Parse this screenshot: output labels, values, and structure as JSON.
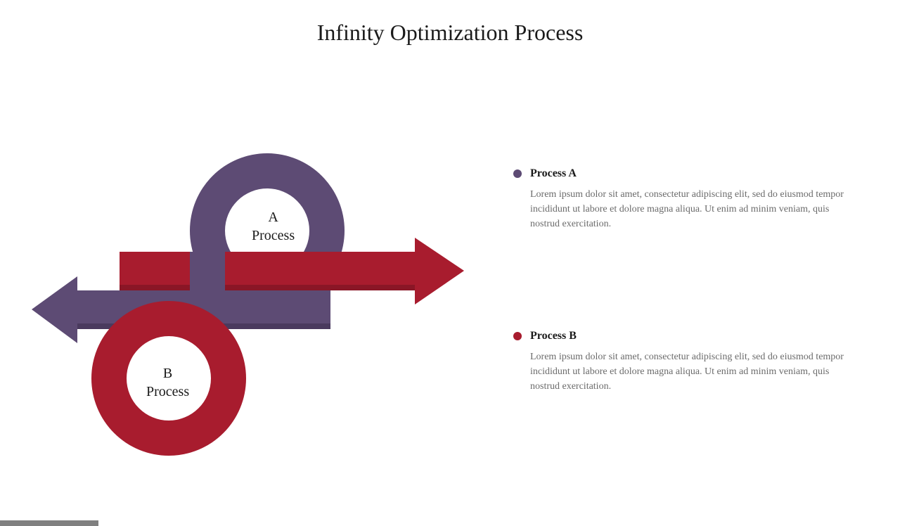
{
  "title": "Infinity Optimization Process",
  "diagram": {
    "labelA_line1": "A",
    "labelA_line2": "Process",
    "labelB_line1": "B",
    "labelB_line2": "Process"
  },
  "processes": [
    {
      "title": "Process A",
      "description": "Lorem ipsum dolor sit amet, consectetur adipiscing elit, sed do eiusmod tempor incididunt ut labore et dolore magna aliqua. Ut enim ad minim veniam, quis nostrud exercitation.",
      "color": "#5d4b74"
    },
    {
      "title": "Process B",
      "description": "Lorem ipsum dolor sit amet, consectetur adipiscing elit, sed do eiusmod tempor incididunt ut labore et dolore magna aliqua. Ut enim ad minim veniam, quis nostrud exercitation.",
      "color": "#a81c2e"
    }
  ],
  "colors": {
    "purple": "#5d4b74",
    "purpleDark": "#4a3a5e",
    "red": "#a81c2e",
    "redDark": "#8a1626"
  }
}
